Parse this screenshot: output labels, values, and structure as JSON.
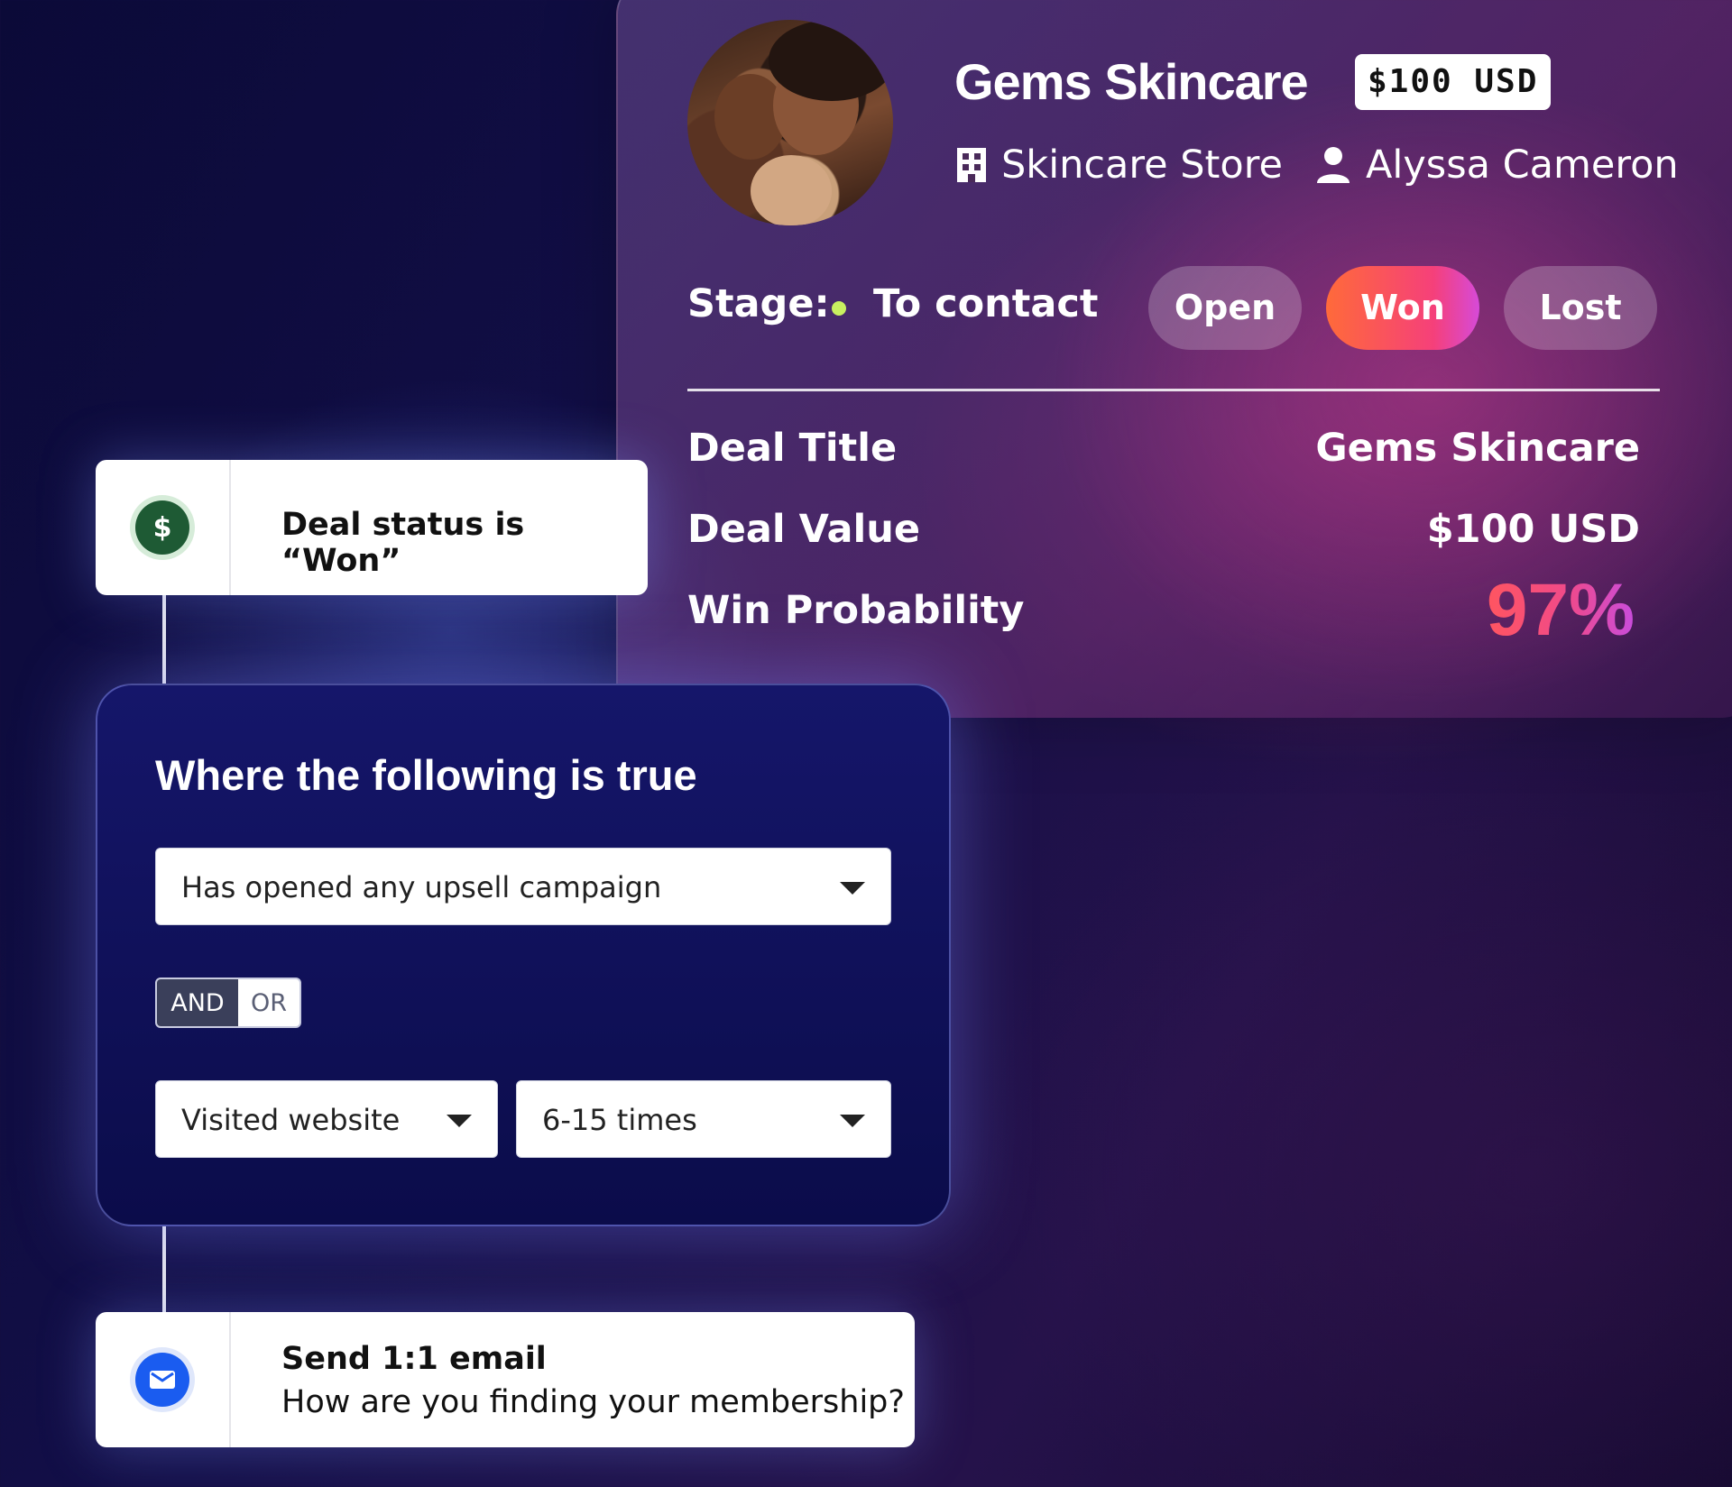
{
  "deal": {
    "name": "Gems Skincare",
    "price_badge": "$100 USD",
    "company": "Skincare Store",
    "contact": "Alyssa Cameron",
    "stage_label": "Stage:",
    "stage_value": "To contact",
    "status_buttons": [
      "Open",
      "Won",
      "Lost"
    ],
    "fields": [
      {
        "label": "Deal Title",
        "value": "Gems Skincare"
      },
      {
        "label": "Deal Value",
        "value": "$100 USD"
      },
      {
        "label": "Win Probability",
        "value": "97%"
      }
    ]
  },
  "workflow": {
    "trigger": {
      "text": "Deal status is “Won”",
      "icon": "dollar-icon"
    },
    "condition": {
      "title": "Where the following is true",
      "select1": "Has opened any upsell campaign",
      "operator_and": "AND",
      "operator_or": "OR",
      "select2": "Visited website",
      "select3": "6-15 times"
    },
    "action": {
      "title": "Send 1:1 email",
      "subtitle": "How are you finding your membership?",
      "icon": "email-icon"
    }
  },
  "colors": {
    "won_gradient_start": "#ff6a3a",
    "won_gradient_end": "#d64ad8",
    "stage_dot": "#c8f060",
    "dollar_icon": "#1e5a34",
    "email_icon": "#1a5cf0",
    "condition_bg": "#15166a"
  }
}
